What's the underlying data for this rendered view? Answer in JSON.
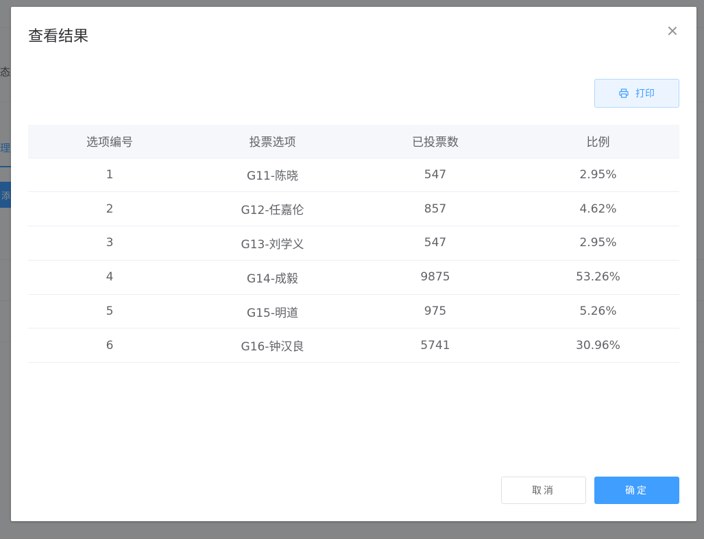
{
  "background": {
    "status_label": "态：",
    "tab_label": "理",
    "add_button_label": "添"
  },
  "dialog": {
    "title": "查看结果",
    "print_label": "打印",
    "cancel_label": "取消",
    "ok_label": "确定"
  },
  "table": {
    "headers": [
      "选项编号",
      "投票选项",
      "已投票数",
      "比例"
    ],
    "rows": [
      [
        "1",
        "G11-陈晓",
        "547",
        "2.95%"
      ],
      [
        "2",
        "G12-任嘉伦",
        "857",
        "4.62%"
      ],
      [
        "3",
        "G13-刘学义",
        "547",
        "2.95%"
      ],
      [
        "4",
        "G14-成毅",
        "9875",
        "53.26%"
      ],
      [
        "5",
        "G15-明道",
        "975",
        "5.26%"
      ],
      [
        "6",
        "G16-钟汉良",
        "5741",
        "30.96%"
      ]
    ]
  },
  "colors": {
    "primary": "#409eff",
    "header_bg": "#f5f7fa",
    "text": "#606266"
  }
}
